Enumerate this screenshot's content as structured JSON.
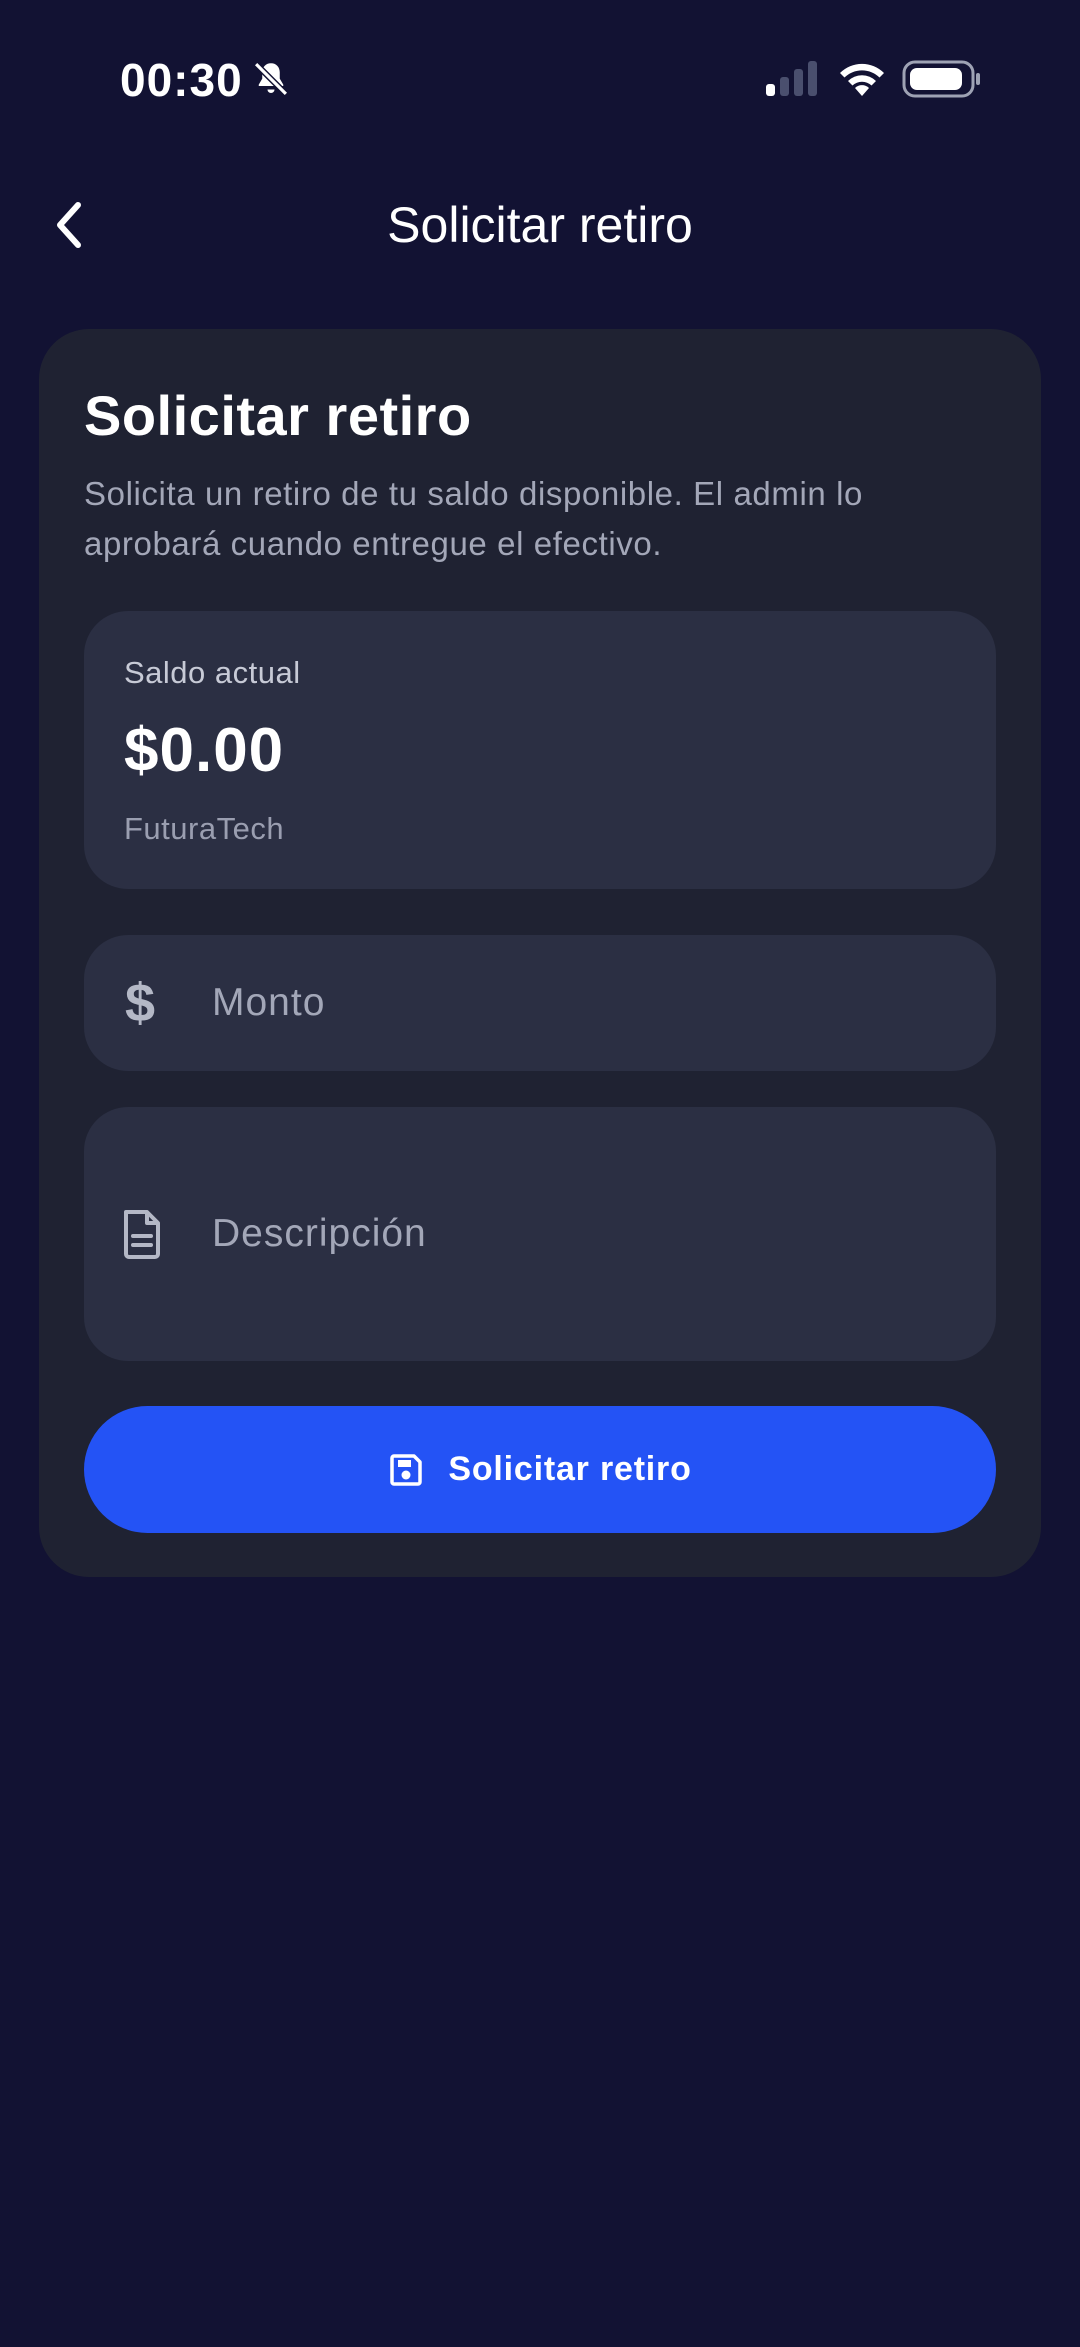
{
  "status_bar": {
    "time": "00:30",
    "icons": [
      "bell-off-icon",
      "signal-icon",
      "wifi-icon",
      "battery-icon"
    ]
  },
  "header": {
    "title": "Solicitar retiro",
    "back_icon": "chevron-left-icon"
  },
  "card": {
    "title": "Solicitar retiro",
    "description": "Solicita un retiro de tu saldo disponible. El admin lo aprobará cuando entregue el efectivo."
  },
  "balance": {
    "label": "Saldo actual",
    "amount": "$0.00",
    "company": "FuturaTech"
  },
  "amount_field": {
    "icon": "dollar-icon",
    "placeholder": "Monto",
    "value": ""
  },
  "description_field": {
    "icon": "document-icon",
    "placeholder": "Descripción",
    "value": ""
  },
  "submit": {
    "icon": "save-icon",
    "label": "Solicitar retiro"
  },
  "colors": {
    "background": "#121233",
    "card": "#1f2232",
    "field": "#2b2f43",
    "accent": "#2453f5",
    "muted_text": "#a3a7b8"
  }
}
